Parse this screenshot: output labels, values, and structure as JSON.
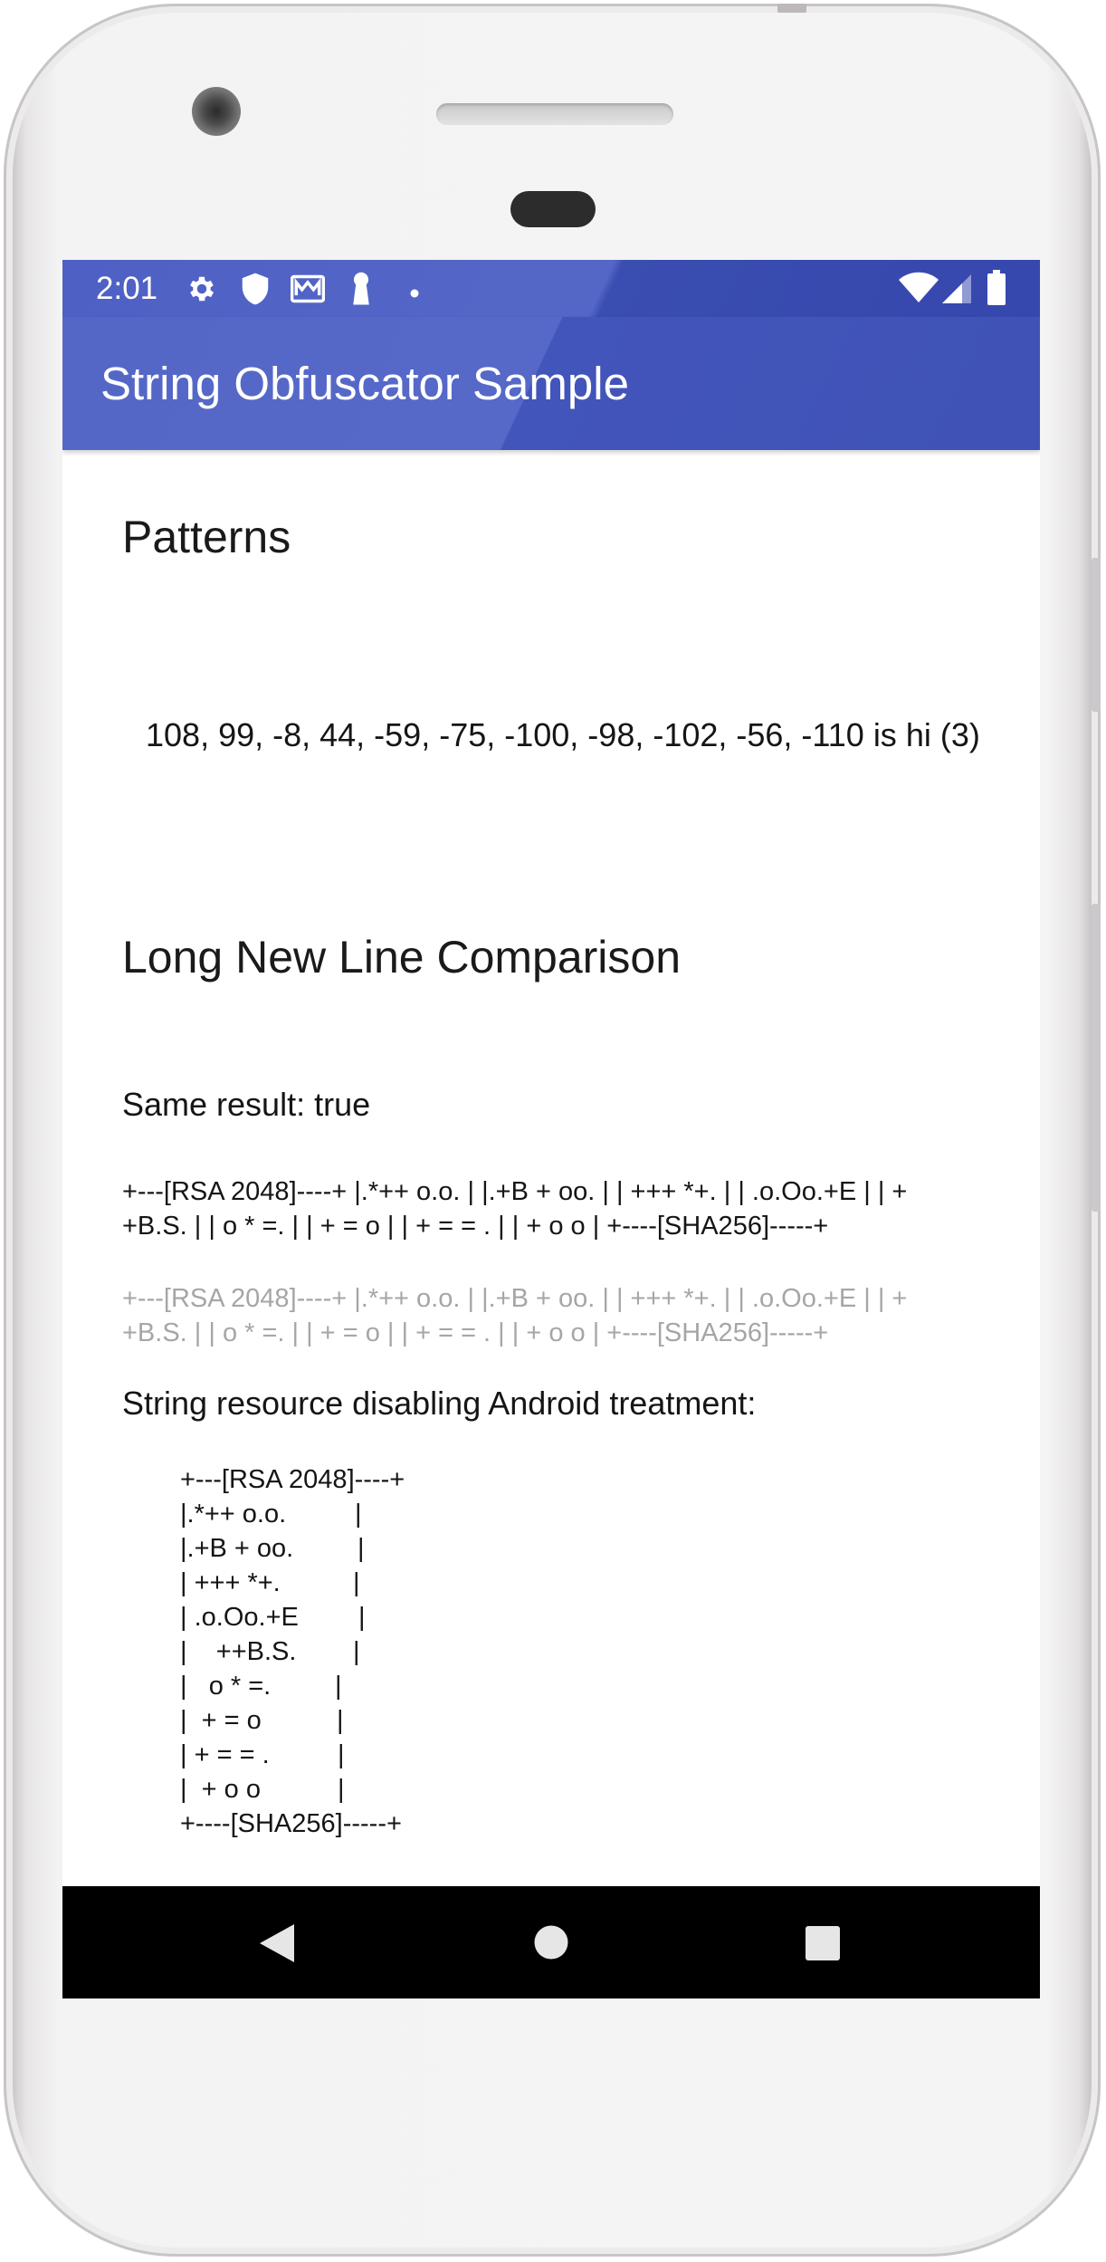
{
  "status_bar": {
    "time": "2:01",
    "left_icons": [
      "gear-icon",
      "shield-icon",
      "mail-icon",
      "keyhole-icon",
      "dot-icon"
    ],
    "right_icons": [
      "wifi-icon",
      "signal-icon",
      "battery-icon"
    ]
  },
  "app_bar": {
    "title": "String Obfuscator Sample",
    "color": "#5064C6"
  },
  "content": {
    "patterns_heading": "Patterns",
    "patterns_text": "108, 99, -8, 44, -59, -75, -100, -98, -102, -56, -110 is hi (3)",
    "comparison_heading": "Long New Line Comparison",
    "same_result": "Same result: true",
    "line1_a": "+---[RSA 2048]----+ |.*++ o.o. | |.+B + oo. | | +++ *+. | | .o.Oo.+E | | +",
    "line1_b": "+B.S. | | o * =. | | + = o | | + = = . | | + o o | +----[SHA256]-----+",
    "line2_a": "+---[RSA 2048]----+ |.*++ o.o. | |.+B + oo. | | +++ *+. | | .o.Oo.+E | | +",
    "line2_b": "+B.S. | | o * =. | | + = o | | + = = . | | + o o | +----[SHA256]-----+",
    "resource_label": "String resource disabling Android treatment:",
    "ascii_lines": [
      "+---[RSA 2048]----+",
      "|.*++ o.o.",
      "|.+B + oo.",
      "| +++ *+.",
      "| .o.Oo.+E",
      "|    ++B.S.",
      "|   o * =.",
      "|  + = o",
      "| + = = .",
      "|  + o o",
      "+----[SHA256]-----+"
    ],
    "ascii_right_bar": "|"
  },
  "nav_bar": {
    "back": "back-triangle-icon",
    "home": "home-circle-icon",
    "recents": "recents-square-icon"
  }
}
